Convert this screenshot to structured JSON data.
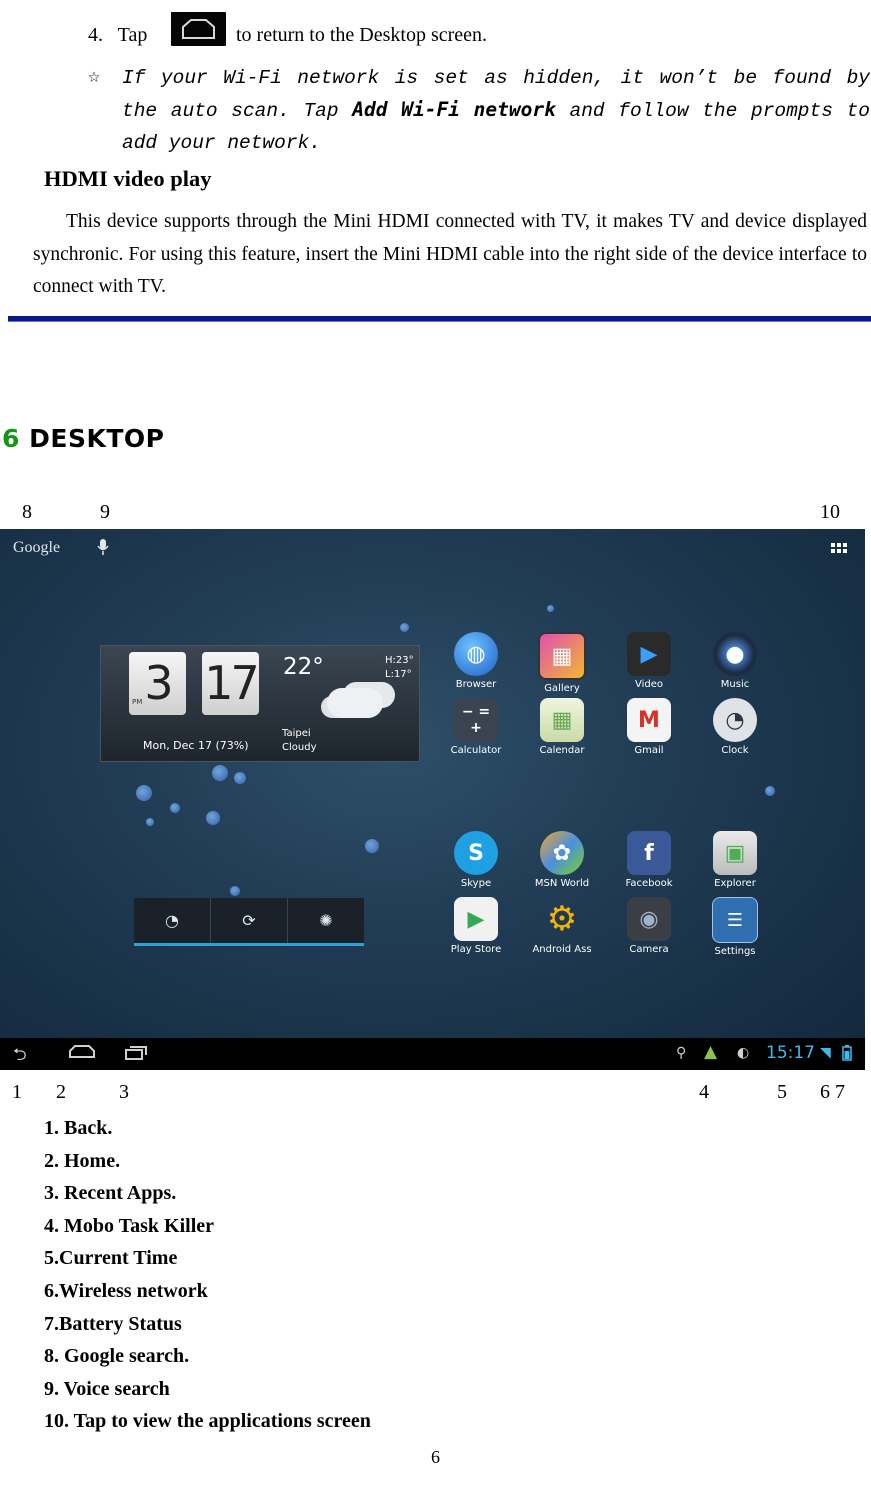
{
  "instructions": {
    "step4_number": "4.",
    "step4_before": "Tap",
    "step4_after": "to return to the Desktop screen.",
    "note_star": "☆",
    "note_part1": "If your Wi-Fi network is set as hidden, it won’t be found by the auto scan. Tap ",
    "note_bold": "Add Wi-Fi network",
    "note_part2": " and follow the prompts to add your network."
  },
  "hdmi": {
    "heading": "HDMI video play",
    "paragraph": "This device supports through the Mini HDMI connected with TV, it makes TV and device displayed synchronic. For using this feature, insert the Mini HDMI cable into the right side of the device interface to connect with TV."
  },
  "section": {
    "number": "6",
    "title": "DESKTOP"
  },
  "callouts_top": [
    "8",
    "9",
    "10"
  ],
  "callouts_bottom": [
    "1",
    "2",
    "3",
    "4",
    "5",
    "6 7"
  ],
  "screenshot": {
    "search_logo": "Google",
    "clock_hour": "3",
    "clock_minute": "17",
    "clock_ampm": "PM",
    "temperature": "22°",
    "high": "H:23°",
    "low": "L:17°",
    "date_battery": "Mon, Dec 17 (73%)",
    "city": "Taipei",
    "condition": "Cloudy",
    "apps_row1": [
      "Browser",
      "Gallery",
      "Video",
      "Music"
    ],
    "apps_row2": [
      "Calculator",
      "Calendar",
      "Gmail",
      "Clock"
    ],
    "apps_row3": [
      "Skype",
      "MSN World",
      "Facebook",
      "Explorer"
    ],
    "apps_row4": [
      "Play Store",
      "Android Ass",
      "Camera",
      "Settings"
    ],
    "status_time": "15:17"
  },
  "legend": [
    "1. Back.",
    "2. Home.",
    "3. Recent Apps.",
    "4. Mobo Task Killer",
    "5.Current Time",
    "6.Wireless network",
    "7.Battery Status",
    "8. Google search.",
    "9. Voice search",
    "10. Tap to view the applications screen"
  ],
  "page_number": "6"
}
